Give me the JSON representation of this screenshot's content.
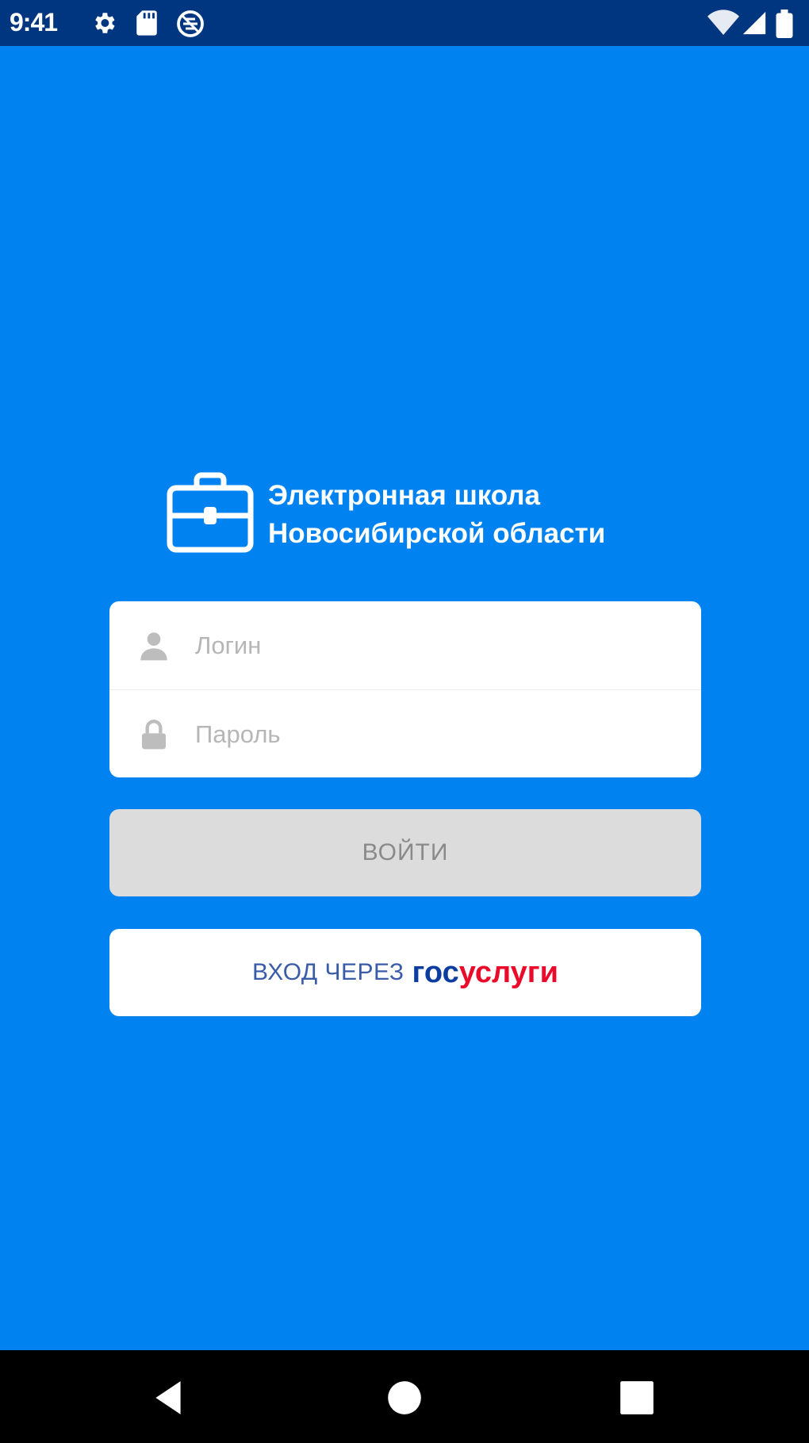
{
  "status_bar": {
    "time": "9:41",
    "left_icons": [
      "settings-icon",
      "sd-card-icon",
      "no-data-icon"
    ],
    "right_icons": [
      "wifi-icon",
      "signal-icon",
      "battery-icon"
    ]
  },
  "brand": {
    "line1": "Электронная школа",
    "line2": "Новосибирской области",
    "logo_icon": "briefcase-icon"
  },
  "form": {
    "login_placeholder": "Логин",
    "password_placeholder": "Пароль",
    "login_icon": "user-icon",
    "password_icon": "lock-icon"
  },
  "buttons": {
    "login_label": "ВОЙТИ",
    "gosuslugi_prefix": "ВХОД ЧЕРЕЗ",
    "gosuslugi_part1": "гос",
    "gosuslugi_part2": "услуги"
  },
  "nav": {
    "back_icon": "back-icon",
    "home_icon": "home-icon",
    "recents_icon": "recents-icon"
  },
  "colors": {
    "background": "#0082f0",
    "status_bar": "#003580",
    "login_button": "#dcdcdc",
    "gos_blue": "#0d3d9e",
    "gos_red": "#ea0a2a"
  }
}
